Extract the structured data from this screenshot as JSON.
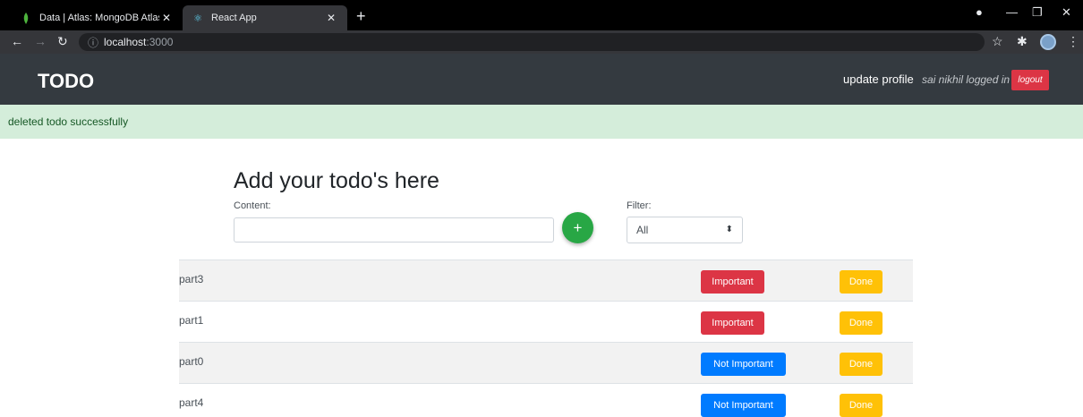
{
  "browser": {
    "tabs": [
      {
        "title": "Data | Atlas: MongoDB Atlas",
        "icon": "mongodb-leaf-icon",
        "active": false
      },
      {
        "title": "React App",
        "icon": "react-icon",
        "active": true
      }
    ],
    "url_host": "localhost",
    "url_port": ":3000"
  },
  "navbar": {
    "brand": "TODO",
    "update_profile": "update profile",
    "logged_in": "sai nikhil logged in",
    "logout": "logout"
  },
  "alert": {
    "message": "deleted todo successfully"
  },
  "form": {
    "heading": "Add your todo's here",
    "content_label": "Content:",
    "content_value": "",
    "add_icon": "+",
    "filter_label": "Filter:",
    "filter_value": "All"
  },
  "todos": [
    {
      "text": "part3",
      "importance": "Important",
      "done": "Done"
    },
    {
      "text": "part1",
      "importance": "Important",
      "done": "Done"
    },
    {
      "text": "part0",
      "importance": "Not Important",
      "done": "Done"
    },
    {
      "text": "part4",
      "importance": "Not Important",
      "done": "Done"
    }
  ],
  "colors": {
    "navbar": "#343a40",
    "alert_bg": "#d4edda",
    "important": "#dc3545",
    "not_important": "#007bff",
    "done": "#ffc107",
    "add": "#28a745"
  }
}
